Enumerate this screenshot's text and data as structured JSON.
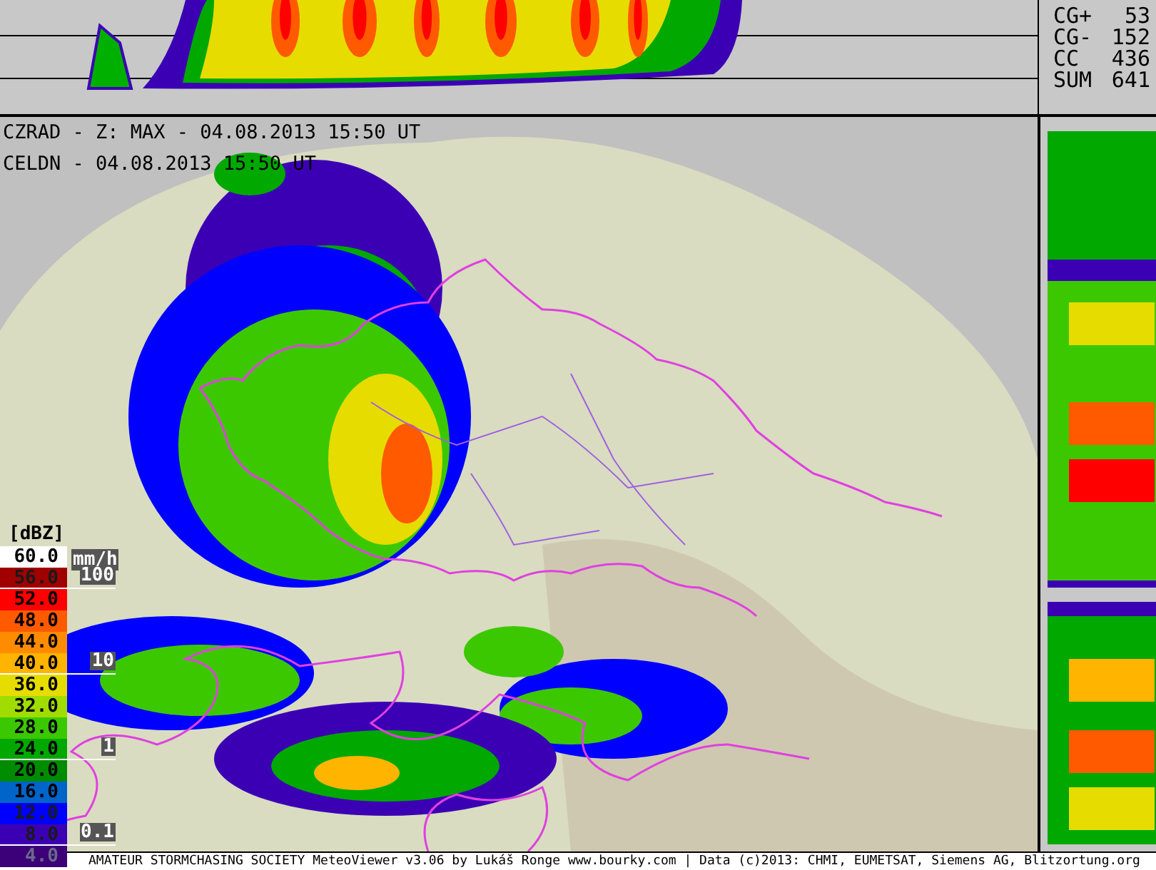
{
  "header": {
    "radar_line": "CZRAD - Z: MAX - 04.08.2013 15:50 UT",
    "lightning_line": "CELDN - 04.08.2013 15:50 UT"
  },
  "lightning_counts": [
    {
      "label": "CG+",
      "value": "53"
    },
    {
      "label": "CG-",
      "value": "152"
    },
    {
      "label": "CC",
      "value": "436"
    },
    {
      "label": "SUM",
      "value": "641"
    }
  ],
  "legend": {
    "unit": "[dBZ]",
    "levels": [
      {
        "label": "60.0",
        "color": "#ffffff"
      },
      {
        "label": "56.0",
        "color": "#a00000"
      },
      {
        "label": "52.0",
        "color": "#ff0000"
      },
      {
        "label": "48.0",
        "color": "#ff5a00"
      },
      {
        "label": "44.0",
        "color": "#ff8c00"
      },
      {
        "label": "40.0",
        "color": "#ffb400"
      },
      {
        "label": "36.0",
        "color": "#e6dc00"
      },
      {
        "label": "32.0",
        "color": "#a0dc00"
      },
      {
        "label": "28.0",
        "color": "#3cc800"
      },
      {
        "label": "24.0",
        "color": "#00a800"
      },
      {
        "label": "20.0",
        "color": "#008c00"
      },
      {
        "label": "16.0",
        "color": "#0064c8"
      },
      {
        "label": "12.0",
        "color": "#0000ff"
      },
      {
        "label": "8.0",
        "color": "#3c00b4"
      },
      {
        "label": "4.0",
        "color": "#3c0078"
      }
    ]
  },
  "rain_scale": {
    "unit": "mm/h",
    "ticks": [
      "100",
      "10",
      "1",
      "0.1"
    ]
  },
  "footer": "AMATEUR STORMCHASING SOCIETY MeteoViewer v3.06 by Lukáš Ronge www.bourky.com | Data (c)2013: CHMI, EUMETSAT, Siemens AG, Blitzortung.org"
}
